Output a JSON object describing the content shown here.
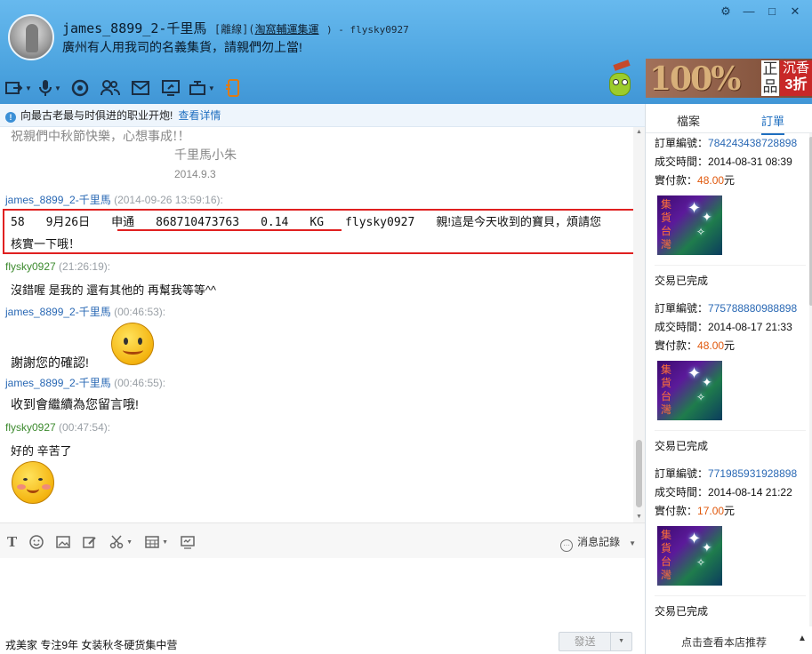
{
  "header": {
    "nickname": "james_8899_2-千里馬",
    "status": "[離線](",
    "shop_name": "淘窩輔運集運",
    "self_suffix": ") - flysky0927",
    "signature": "廣州有人用我司的名義集貨，請親們勿上當!",
    "window_controls": [
      "⚙",
      "—",
      "□",
      "✕"
    ]
  },
  "toolbar": {
    "items": [
      "transfer-file-icon",
      "voice-icon",
      "video-icon",
      "contacts-icon",
      "mail-icon",
      "share-screen-icon",
      "remote-icon",
      "phone-icon"
    ]
  },
  "banner": {
    "number": "100%",
    "zhengpin_1": "正",
    "zhengpin_2": "品",
    "chenxiang": "沉香",
    "zhe": "3折"
  },
  "notice": {
    "text": "向最古老最与时俱进的职业开炮!",
    "link": "查看详情"
  },
  "messages": {
    "greeting": "祝親們中秋節快樂，心想事成!！",
    "greeting_sig": "千里馬小朱",
    "greeting_date": "2014.9.3",
    "m1_sender": "james_8899_2-千里馬",
    "m1_time": "(2014-09-26 13:59:16):",
    "m1_cols": [
      "58",
      "9月26日",
      "申通",
      "868710473763",
      "0.14",
      "KG",
      "flysky0927"
    ],
    "m1_text": "親!這是今天收到的寶貝，煩請您",
    "m1_text2": "核實一下哦！",
    "m2_sender": "flysky0927",
    "m2_time": "(21:26:19):",
    "m2_text": "沒錯喔 是我的 還有其他的 再幫我等等^^",
    "m3_sender": "james_8899_2-千里馬",
    "m3_time": "(00:46:53):",
    "m3_text": "謝謝您的確認!",
    "m4_sender": "james_8899_2-千里馬",
    "m4_time": "(00:46:55):",
    "m4_text": "收到會繼續為您留言哦!",
    "m5_sender": "flysky0927",
    "m5_time": "(00:47:54):",
    "m5_text": "好的 辛苦了"
  },
  "input": {
    "history_label": "消息記錄",
    "placeholder": "",
    "send_label": "發送",
    "ad_text": "戎美家 专注9年 女装秋冬硬货集中营"
  },
  "right_panel": {
    "tab_files": "檔案",
    "tab_orders": "訂單",
    "order_no_label": "訂單編號：",
    "deal_time_label": "成交時間：",
    "paid_label": "實付款：",
    "yuan": "元",
    "thumb_text": "集貨台灣",
    "orders": [
      {
        "no": "784243438728898",
        "time": "2014-08-31 08:39",
        "paid": "48.00",
        "status": "交易已完成"
      },
      {
        "no": "775788880988898",
        "time": "2014-08-17 21:33",
        "paid": "48.00",
        "status": "交易已完成"
      },
      {
        "no": "771985931928898",
        "time": "2014-08-14 21:22",
        "paid": "17.00",
        "status": "交易已完成"
      }
    ],
    "footer": "点击查看本店推荐"
  },
  "colors": {
    "header_blue": "#4aa2de",
    "link_blue": "#2968b4",
    "self_green": "#3c8a2e",
    "highlight_red": "#e02020",
    "price_orange": "#e0580c"
  }
}
